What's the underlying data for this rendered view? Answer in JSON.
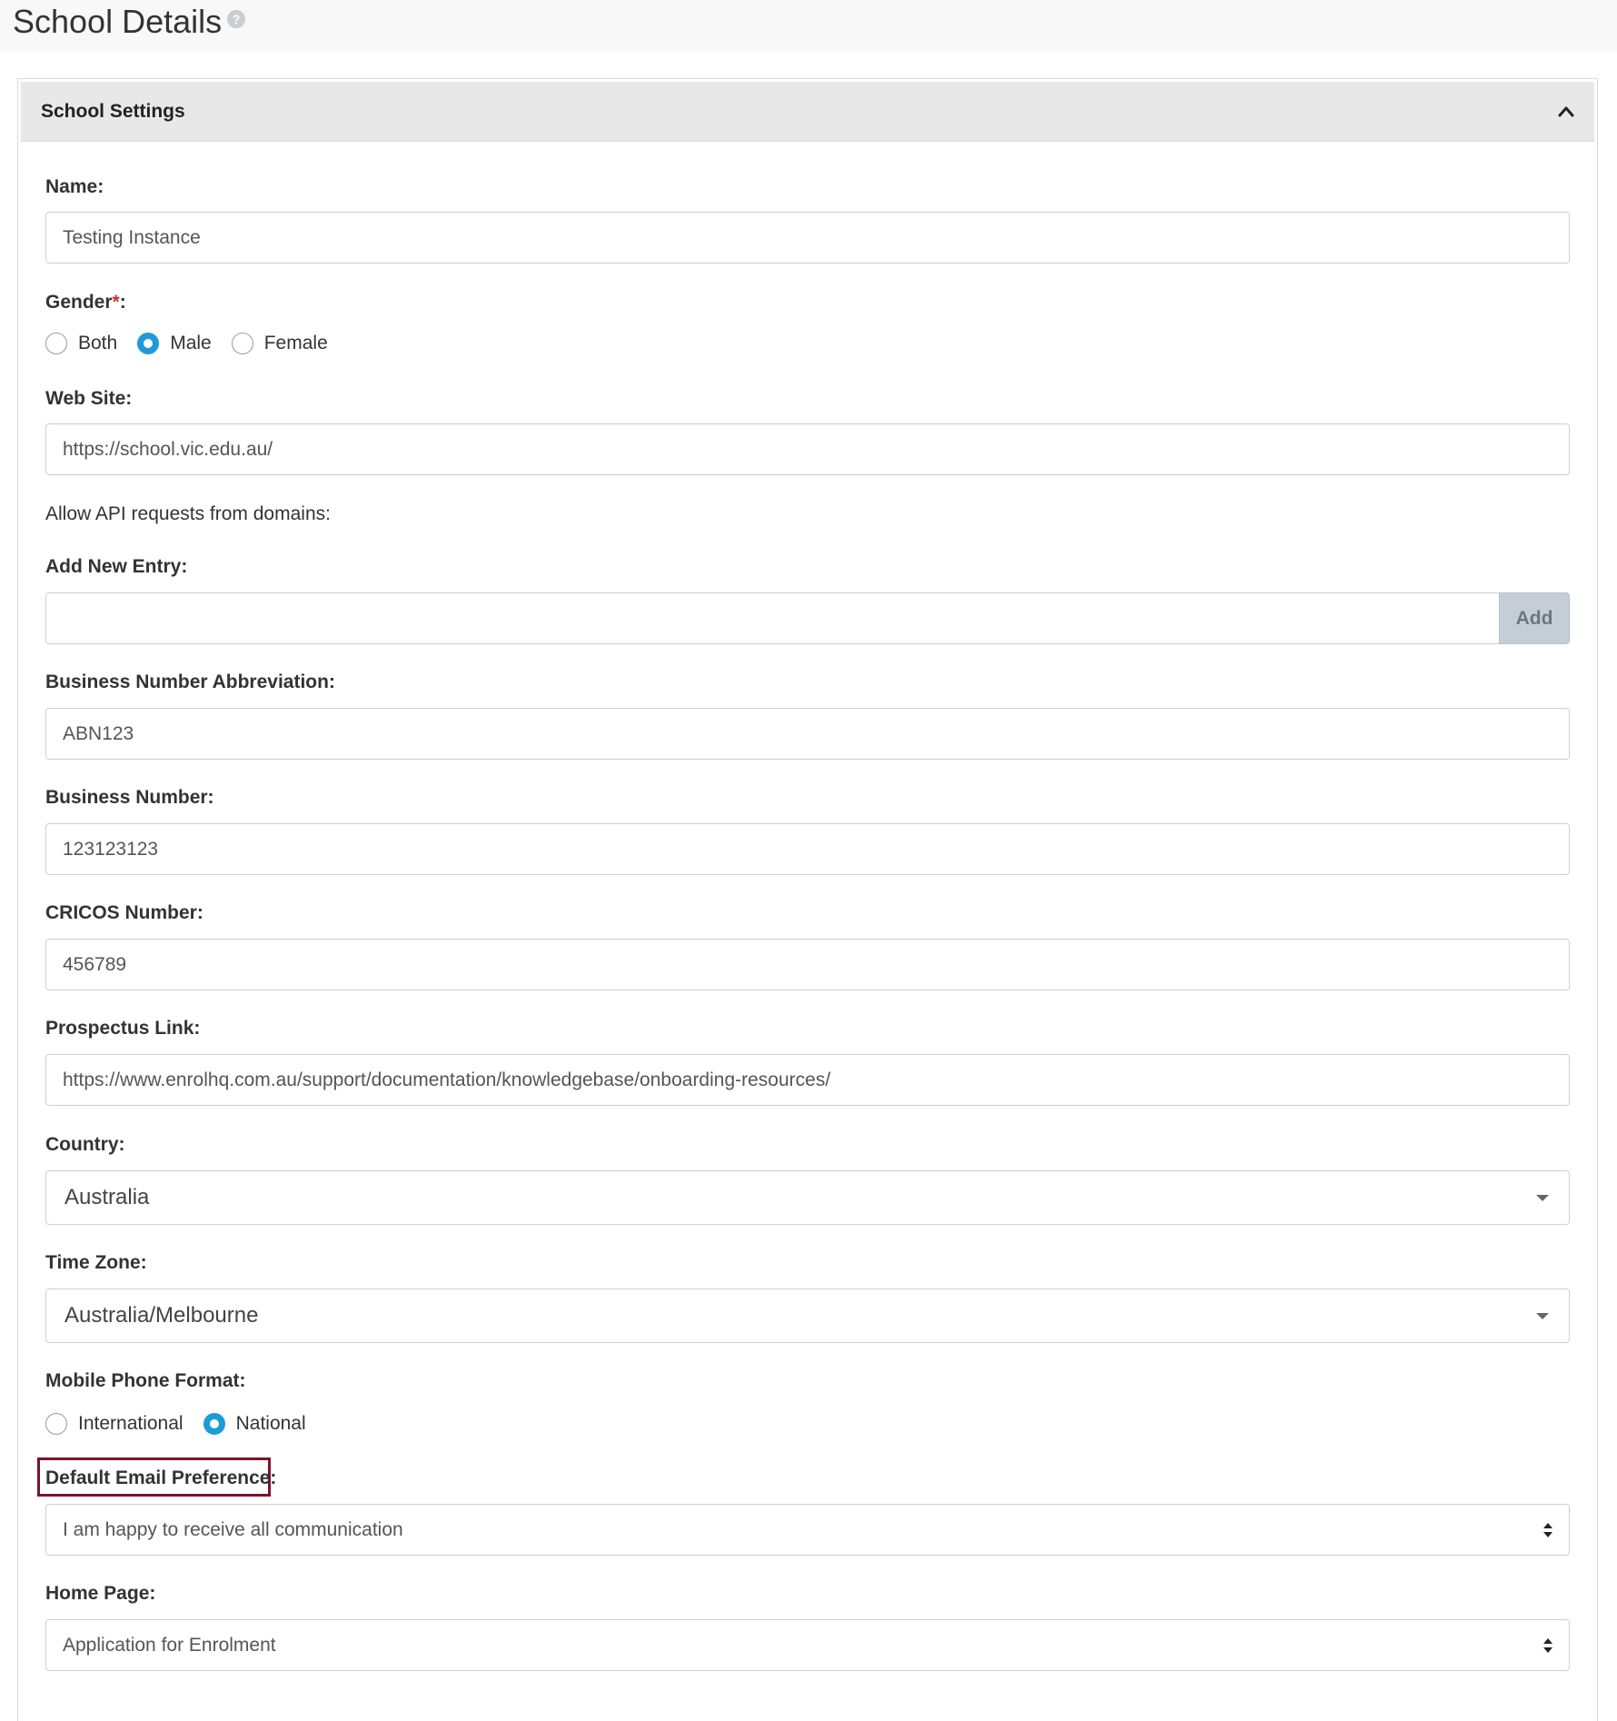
{
  "page": {
    "title": "School Details",
    "help_glyph": "?"
  },
  "panel": {
    "title": "School Settings"
  },
  "form": {
    "name": {
      "label": "Name:",
      "value": "Testing Instance"
    },
    "gender": {
      "label": "Gender",
      "required_mark": "*",
      "colon": ":",
      "options": [
        "Both",
        "Male",
        "Female"
      ],
      "selected": "Male"
    },
    "website": {
      "label": "Web Site:",
      "value": "https://school.vic.edu.au/"
    },
    "api_domains": {
      "label": "Allow API requests from domains:"
    },
    "add_entry": {
      "label": "Add New Entry:",
      "value": "",
      "button": "Add"
    },
    "business_abbrev": {
      "label": "Business Number Abbreviation:",
      "value": "ABN123"
    },
    "business_number": {
      "label": "Business Number:",
      "value": "123123123"
    },
    "cricos": {
      "label": "CRICOS Number:",
      "value": "456789"
    },
    "prospectus": {
      "label": "Prospectus Link:",
      "value": "https://www.enrolhq.com.au/support/documentation/knowledgebase/onboarding-resources/"
    },
    "country": {
      "label": "Country:",
      "value": "Australia"
    },
    "timezone": {
      "label": "Time Zone:",
      "value": "Australia/Melbourne"
    },
    "mobile_format": {
      "label": "Mobile Phone Format:",
      "options": [
        "International",
        "National"
      ],
      "selected": "National"
    },
    "email_pref": {
      "label": "Default Email Preference:",
      "value": "I am happy to receive all communication"
    },
    "home_page": {
      "label": "Home Page:",
      "value": "Application for Enrolment"
    }
  },
  "colors": {
    "accent": "#1e9bd7",
    "highlight": "#7a1428",
    "required": "#c0392b"
  }
}
